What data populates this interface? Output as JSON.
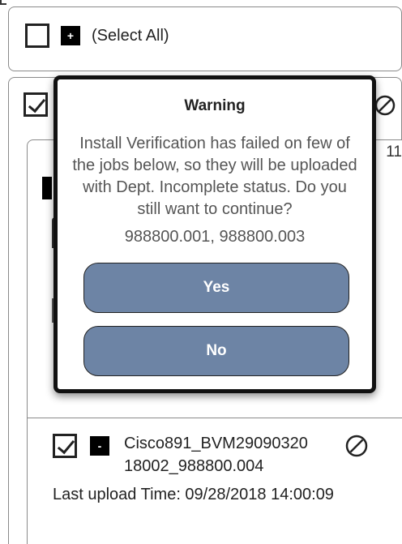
{
  "select_all": {
    "label": "(Select All)",
    "expand_symbol": "+",
    "checked": false
  },
  "list": {
    "header_checked": true,
    "side_number": "11"
  },
  "modal": {
    "title": "Warning",
    "message": "Install Verification has failed on few of the jobs below, so they will be uploaded with Dept. Incomplete status. Do you still want to continue?",
    "job_numbers": "988800.001, 988800.003",
    "yes_label": "Yes",
    "no_label": "No"
  },
  "item": {
    "checked": true,
    "collapse_symbol": "-",
    "title": "Cisco891_BVM29090320 18002_988800.004",
    "upload_time": "Last upload Time: 09/28/2018 14:00:09"
  },
  "icons": {
    "ban": "ban-icon",
    "checkbox": "checkbox-icon"
  },
  "colors": {
    "button_fill": "#6d84a5",
    "modal_border": "#111111",
    "card_border": "#8a8a8a"
  }
}
